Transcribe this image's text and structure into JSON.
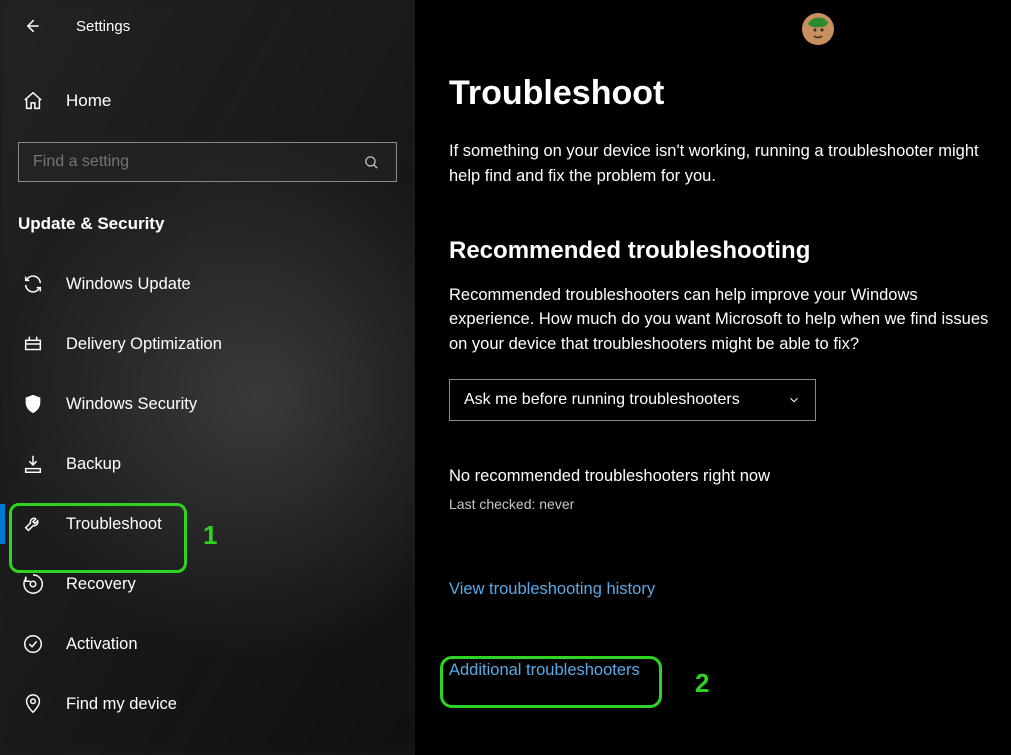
{
  "header": {
    "app_title": "Settings"
  },
  "sidebar": {
    "home_label": "Home",
    "search_placeholder": "Find a setting",
    "section_title": "Update & Security",
    "items": [
      {
        "icon": "sync",
        "label": "Windows Update"
      },
      {
        "icon": "delivery",
        "label": "Delivery Optimization"
      },
      {
        "icon": "shield",
        "label": "Windows Security"
      },
      {
        "icon": "backup",
        "label": "Backup"
      },
      {
        "icon": "wrench",
        "label": "Troubleshoot",
        "selected": true
      },
      {
        "icon": "recovery",
        "label": "Recovery"
      },
      {
        "icon": "check",
        "label": "Activation"
      },
      {
        "icon": "location",
        "label": "Find my device"
      }
    ]
  },
  "main": {
    "title": "Troubleshoot",
    "intro": "If something on your device isn't working, running a troubleshooter might help find and fix the problem for you.",
    "recommended_heading": "Recommended troubleshooting",
    "recommended_text": "Recommended troubleshooters can help improve your Windows experience. How much do you want Microsoft to help when we find issues on your device that troubleshooters might be able to fix?",
    "dropdown_value": "Ask me before running troubleshooters",
    "status": "No recommended troubleshooters right now",
    "last_checked": "Last checked: never",
    "link_history": "View troubleshooting history",
    "link_additional": "Additional troubleshooters"
  },
  "annotations": {
    "one": "1",
    "two": "2"
  }
}
